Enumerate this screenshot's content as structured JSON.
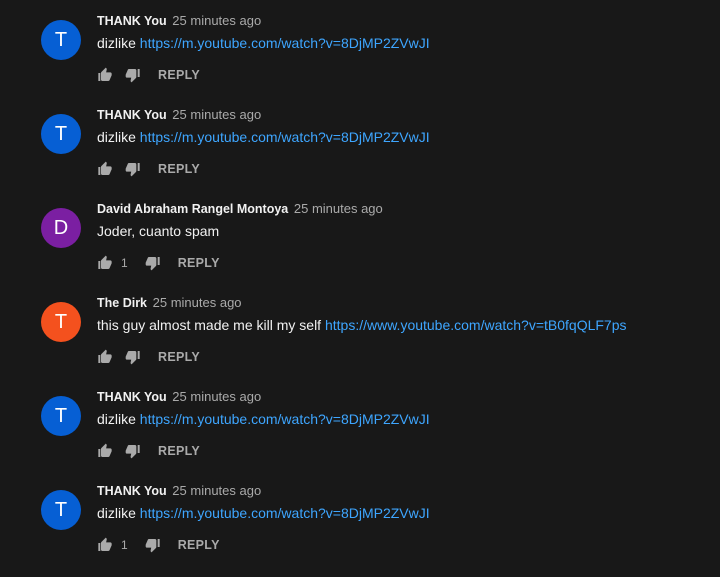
{
  "colors": {
    "background": "#181818",
    "link": "#3ea6ff",
    "secondary_text": "#aaaaaa",
    "primary_text": "#f1f1f1"
  },
  "comments": [
    {
      "avatar_letter": "T",
      "avatar_color": "#065fd4",
      "author": "THANK You",
      "time": "25 minutes ago",
      "text": "dizlike ",
      "link": "https://m.youtube.com/watch?v=8DjMP2ZVwJI",
      "likes": "",
      "reply_label": "REPLY"
    },
    {
      "avatar_letter": "T",
      "avatar_color": "#065fd4",
      "author": "THANK You",
      "time": "25 minutes ago",
      "text": "dizlike ",
      "link": "https://m.youtube.com/watch?v=8DjMP2ZVwJI",
      "likes": "",
      "reply_label": "REPLY"
    },
    {
      "avatar_letter": "D",
      "avatar_color": "#7b1fa2",
      "author": "David Abraham Rangel Montoya",
      "time": "25 minutes ago",
      "text": "Joder, cuanto spam",
      "link": "",
      "likes": "1",
      "reply_label": "REPLY"
    },
    {
      "avatar_letter": "T",
      "avatar_color": "#f4511e",
      "author": "The Dirk",
      "time": "25 minutes ago",
      "text": "this guy almost made me kill my self ",
      "link": "https://www.youtube.com/watch?v=tB0fqQLF7ps",
      "likes": "",
      "reply_label": "REPLY"
    },
    {
      "avatar_letter": "T",
      "avatar_color": "#065fd4",
      "author": "THANK You",
      "time": "25 minutes ago",
      "text": "dizlike ",
      "link": "https://m.youtube.com/watch?v=8DjMP2ZVwJI",
      "likes": "",
      "reply_label": "REPLY"
    },
    {
      "avatar_letter": "T",
      "avatar_color": "#065fd4",
      "author": "THANK You",
      "time": "25 minutes ago",
      "text": "dizlike ",
      "link": "https://m.youtube.com/watch?v=8DjMP2ZVwJI",
      "likes": "1",
      "reply_label": "REPLY"
    }
  ]
}
